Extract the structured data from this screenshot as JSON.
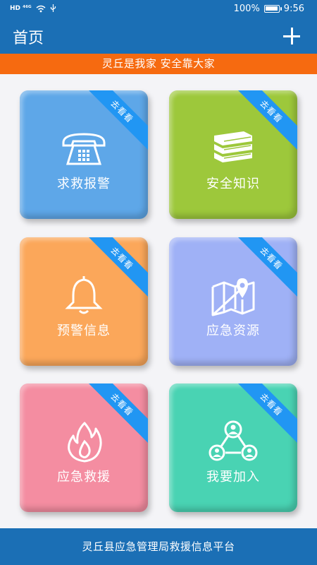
{
  "statusbar": {
    "left": "HD ⁴⁶ᴳ",
    "battery_pct": "100%",
    "battery_level": 1.0,
    "time": "9:56"
  },
  "header": {
    "title": "首页",
    "add_icon": "plus-icon"
  },
  "banner": {
    "text": "灵丘是我家  安全靠大家",
    "color": "#f66a10"
  },
  "tiles": [
    {
      "label": "求救报警",
      "ribbon": "去看看",
      "icon": "telephone-icon",
      "color": "#5ea7e8"
    },
    {
      "label": "安全知识",
      "ribbon": "去看看",
      "icon": "books-icon",
      "color": "#9dc83b"
    },
    {
      "label": "预警信息",
      "ribbon": "去看看",
      "icon": "bell-icon",
      "color": "#fba75a"
    },
    {
      "label": "应急资源",
      "ribbon": "去看看",
      "icon": "map-pin-icon",
      "color": "#9fb1f6"
    },
    {
      "label": "应急救援",
      "ribbon": "去看看",
      "icon": "flame-icon",
      "color": "#f48da1"
    },
    {
      "label": "我要加入",
      "ribbon": "去看看",
      "icon": "network-users-icon",
      "color": "#49d3b3"
    }
  ],
  "footer": {
    "text": "灵丘县应急管理局救援信息平台"
  },
  "theme": {
    "primary": "#1b6fb5",
    "ribbon": "#2196f3"
  }
}
